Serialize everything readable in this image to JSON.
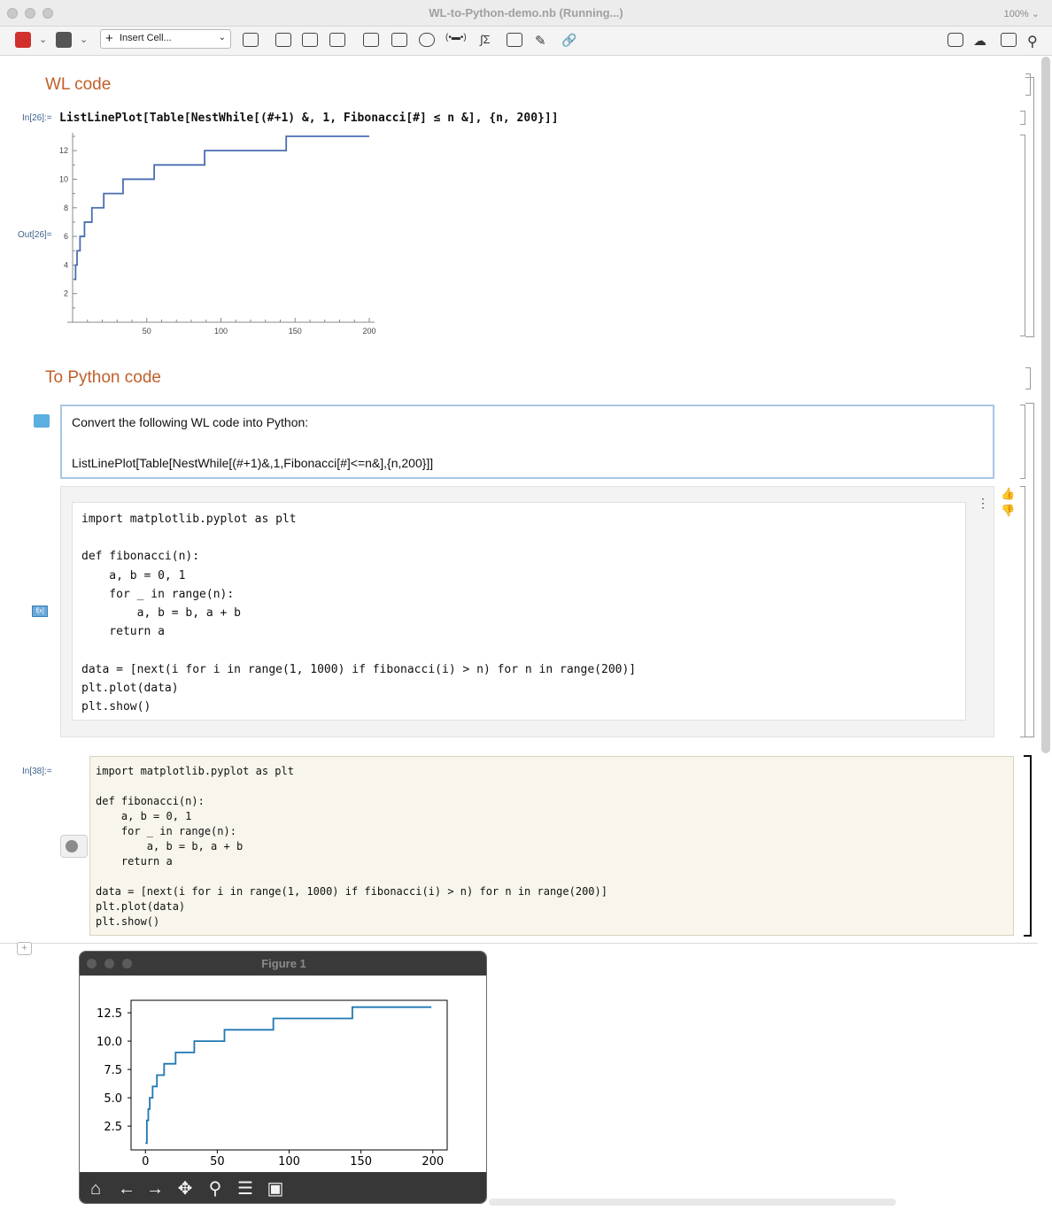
{
  "window": {
    "title": "WL-to-Python-demo.nb (Running...)",
    "zoom": "100%"
  },
  "toolbar": {
    "insert_cell": "Insert Cell..."
  },
  "notebook": {
    "section1": "WL code",
    "in26_label": "In[26]:=",
    "in26_code": "ListLinePlot[Table[NestWhile[(#+1) &, 1, Fibonacci[#] ≤ n &], {n, 200}]]",
    "out26_label": "Out[26]=",
    "section2": "To Python code",
    "prompt_line1": "Convert the following WL code into Python:",
    "prompt_line2": "ListLinePlot[Table[NestWhile[(#+1)&,1,Fibonacci[#]<=n&],{n,200}]]",
    "response_code": "import matplotlib.pyplot as plt\n\ndef fibonacci(n):\n    a, b = 0, 1\n    for _ in range(n):\n        a, b = b, a + b\n    return a\n\ndata = [next(i for i in range(1, 1000) if fibonacci(i) > n) for n in range(200)]\nplt.plot(data)\nplt.show()",
    "fx_icon": "f[x]",
    "in38_label": "In[38]:=",
    "in38_code": "import matplotlib.pyplot as plt\n\ndef fibonacci(n):\n    a, b = 0, 1\n    for _ in range(n):\n        a, b = b, a + b\n    return a\n\ndata = [next(i for i in range(1, 1000) if fibonacci(i) > n) for n in range(200)]\nplt.plot(data)\nplt.show()"
  },
  "figure_window": {
    "title": "Figure 1",
    "tools": [
      {
        "name": "home-icon",
        "glyph": "⌂"
      },
      {
        "name": "back-arrow-icon",
        "glyph": "←"
      },
      {
        "name": "forward-arrow-icon",
        "glyph": "→"
      },
      {
        "name": "pan-icon",
        "glyph": "✥"
      },
      {
        "name": "zoom-icon",
        "glyph": "⚲"
      },
      {
        "name": "configure-subplots-icon",
        "glyph": "☰"
      },
      {
        "name": "save-icon",
        "glyph": "▣"
      }
    ]
  },
  "chart_data": [
    {
      "type": "line",
      "title": "",
      "xlabel": "",
      "ylabel": "",
      "xlim": [
        0,
        200
      ],
      "ylim": [
        0,
        13
      ],
      "xticks": [
        "50",
        "100",
        "150",
        "200"
      ],
      "yticks": [
        "2",
        "4",
        "6",
        "8",
        "10",
        "12"
      ],
      "series": [
        {
          "color": "#4a6eb0",
          "steps": [
            {
              "x": 1,
              "y": 3
            },
            {
              "x": 2,
              "y": 4
            },
            {
              "x": 3,
              "y": 5
            },
            {
              "x": 5,
              "y": 6
            },
            {
              "x": 8,
              "y": 7
            },
            {
              "x": 13,
              "y": 8
            },
            {
              "x": 21,
              "y": 9
            },
            {
              "x": 34,
              "y": 10
            },
            {
              "x": 55,
              "y": 11
            },
            {
              "x": 89,
              "y": 12
            },
            {
              "x": 144,
              "y": 13
            },
            {
              "x": 200,
              "y": 13
            }
          ]
        }
      ],
      "grid": false
    },
    {
      "type": "line",
      "title": "",
      "xlabel": "",
      "ylabel": "",
      "xlim": [
        -10,
        210
      ],
      "ylim": [
        0.4,
        13.6
      ],
      "xticks": [
        "0",
        "50",
        "100",
        "150",
        "200"
      ],
      "yticks": [
        "2.5",
        "5.0",
        "7.5",
        "10.0",
        "12.5"
      ],
      "series": [
        {
          "color": "#1f77b4",
          "steps": [
            {
              "x": 0,
              "y": 1
            },
            {
              "x": 1,
              "y": 3
            },
            {
              "x": 2,
              "y": 4
            },
            {
              "x": 3,
              "y": 5
            },
            {
              "x": 5,
              "y": 6
            },
            {
              "x": 8,
              "y": 7
            },
            {
              "x": 13,
              "y": 8
            },
            {
              "x": 21,
              "y": 9
            },
            {
              "x": 34,
              "y": 10
            },
            {
              "x": 55,
              "y": 11
            },
            {
              "x": 89,
              "y": 12
            },
            {
              "x": 144,
              "y": 13
            },
            {
              "x": 199,
              "y": 13
            }
          ]
        }
      ],
      "grid": false
    }
  ]
}
